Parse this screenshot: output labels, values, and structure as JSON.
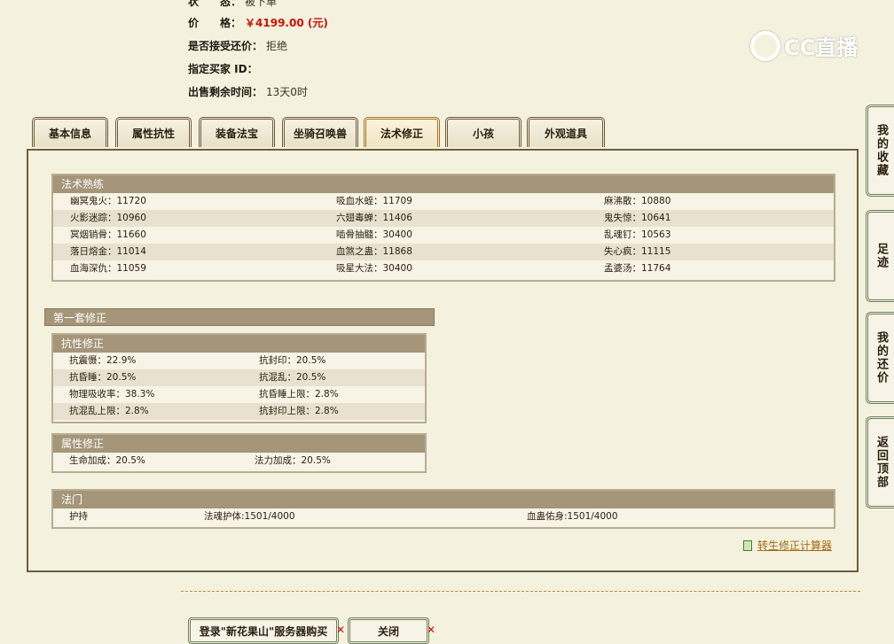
{
  "info": {
    "status_label": "状　　态：",
    "status_value": "被下单",
    "price_label": "价　　格：",
    "price_value": "￥4199.00 (元)",
    "counter_label": "是否接受还价：",
    "counter_value": "拒绝",
    "buyer_label": "指定买家 ID：",
    "buyer_value": "",
    "time_label": "出售剩余时间：",
    "time_value": "13天0时"
  },
  "watermark": {
    "text": "CC直播"
  },
  "tabs": [
    {
      "label": "基本信息"
    },
    {
      "label": "属性抗性"
    },
    {
      "label": "装备法宝"
    },
    {
      "label": "坐骑召唤兽"
    },
    {
      "label": "法术修正",
      "active": true
    },
    {
      "label": "小孩"
    },
    {
      "label": "外观道具"
    }
  ],
  "spell_mastery": {
    "title": "法术熟练",
    "rows": [
      [
        "幽冥鬼火：11720",
        "吸血水蛭：11709",
        "麻沸散：10880"
      ],
      [
        "火影迷踪：10960",
        "六翅毒蝉：11406",
        "鬼失惊：10641"
      ],
      [
        "冥烟销骨：11660",
        "啮骨抽髓：30400",
        "乱魂钉：10563"
      ],
      [
        "落日熔金：11014",
        "血煞之蛊：11868",
        "失心疯：11115"
      ],
      [
        "血海深仇：11059",
        "吸星大法：30400",
        "孟婆汤：11764"
      ]
    ]
  },
  "group1": {
    "title": "第一套修正",
    "resist": {
      "title": "抗性修正",
      "rows": [
        [
          "抗震慑：22.9%",
          "抗封印：20.5%"
        ],
        [
          "抗昏睡：20.5%",
          "抗混乱：20.5%"
        ],
        [
          "物理吸收率：38.3%",
          "抗昏睡上限：2.8%"
        ],
        [
          "抗混乱上限：2.8%",
          "抗封印上限：2.8%"
        ]
      ]
    },
    "attr": {
      "title": "属性修正",
      "rows": [
        [
          "生命加成：20.5%",
          "法力加成：20.5%"
        ]
      ]
    }
  },
  "sect": {
    "title": "法门",
    "cells": [
      "护持",
      "法魂护体:1501/4000",
      "血蛊佑身:1501/4000"
    ]
  },
  "calculator_link": "转生修正计算器",
  "buttons": {
    "buy": "登录\"新花果山\"服务器购买",
    "close": "关闭",
    "x": "✕"
  },
  "side_nav": [
    {
      "label": "我的收藏"
    },
    {
      "label": "足迹"
    },
    {
      "label": "我的还价"
    },
    {
      "label": "返回顶部"
    }
  ]
}
